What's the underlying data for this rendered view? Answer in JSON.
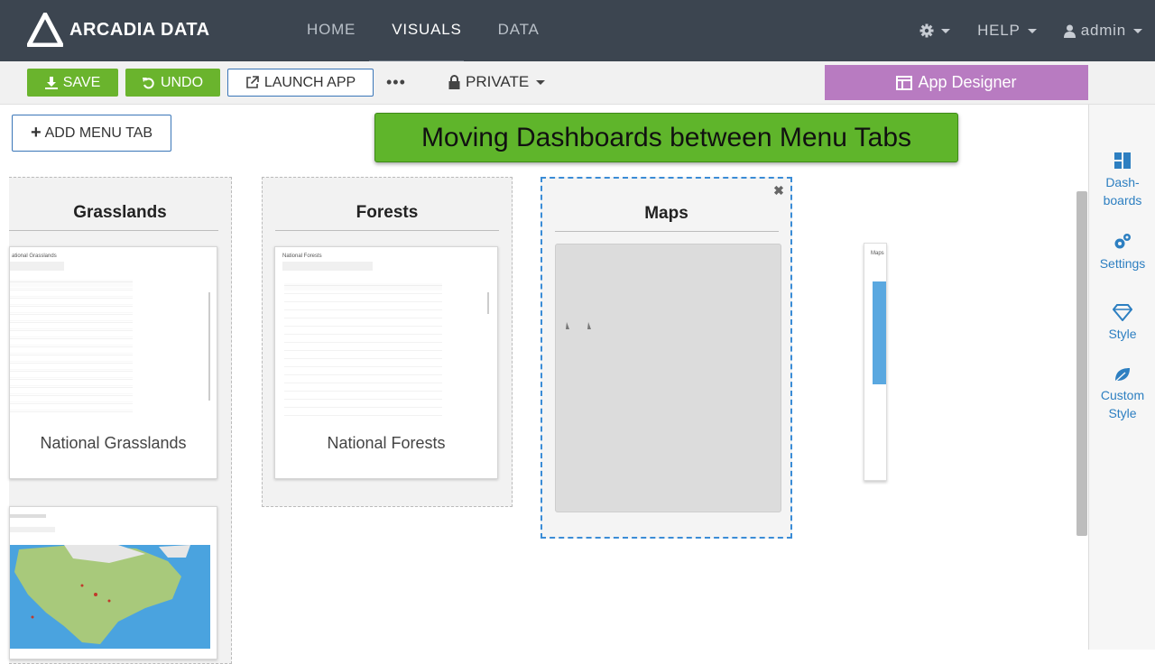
{
  "header": {
    "brand": "ARCADIA DATA",
    "nav": [
      "HOME",
      "VISUALS",
      "DATA"
    ],
    "help": "HELP",
    "user": "admin"
  },
  "toolbar": {
    "save": "SAVE",
    "undo": "UNDO",
    "launch_app": "LAUNCH APP",
    "more": "•••",
    "private": "PRIVATE",
    "app_designer": "App Designer"
  },
  "canvas": {
    "add_menu_tab": "ADD MENU TAB",
    "overlay_caption": "Moving Dashboards between Menu Tabs",
    "tabs": [
      {
        "title": "Grasslands",
        "dashboard": "National Grasslands",
        "thumb_title": "ational Grasslands"
      },
      {
        "title": "Forests",
        "dashboard": "National Forests",
        "thumb_title": "National Forests"
      },
      {
        "title": "Maps"
      }
    ],
    "ghost_thumb_title": "Maps"
  },
  "sidebar": {
    "items": [
      "Dash-\nboards",
      "Settings",
      "Style",
      "Custom Style"
    ]
  },
  "colors": {
    "topbar": "#3c4550",
    "green": "#6ab42d",
    "app_designer": "#b87bc1",
    "link_blue": "#2d7fc1",
    "drop_border": "#3a8cd6"
  }
}
